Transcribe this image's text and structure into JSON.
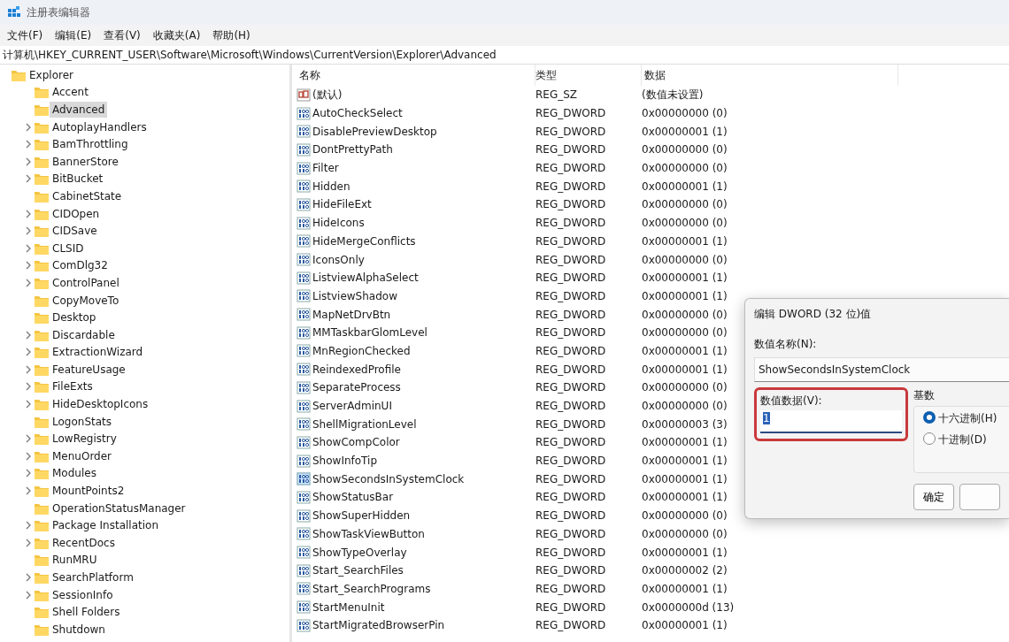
{
  "window": {
    "title": "注册表编辑器"
  },
  "menu": [
    "文件(F)",
    "编辑(E)",
    "查看(V)",
    "收藏夹(A)",
    "帮助(H)"
  ],
  "address": "计算机\\HKEY_CURRENT_USER\\Software\\Microsoft\\Windows\\CurrentVersion\\Explorer\\Advanced",
  "tree": [
    {
      "label": "Explorer",
      "expandable": false,
      "selected": false,
      "children": [
        {
          "label": "Accent",
          "expandable": false,
          "selected": false
        },
        {
          "label": "Advanced",
          "expandable": false,
          "selected": true
        },
        {
          "label": "AutoplayHandlers",
          "expandable": true,
          "selected": false
        },
        {
          "label": "BamThrottling",
          "expandable": true,
          "selected": false
        },
        {
          "label": "BannerStore",
          "expandable": true,
          "selected": false
        },
        {
          "label": "BitBucket",
          "expandable": true,
          "selected": false
        },
        {
          "label": "CabinetState",
          "expandable": false,
          "selected": false
        },
        {
          "label": "CIDOpen",
          "expandable": true,
          "selected": false
        },
        {
          "label": "CIDSave",
          "expandable": true,
          "selected": false
        },
        {
          "label": "CLSID",
          "expandable": true,
          "selected": false
        },
        {
          "label": "ComDlg32",
          "expandable": true,
          "selected": false
        },
        {
          "label": "ControlPanel",
          "expandable": true,
          "selected": false
        },
        {
          "label": "CopyMoveTo",
          "expandable": false,
          "selected": false
        },
        {
          "label": "Desktop",
          "expandable": false,
          "selected": false
        },
        {
          "label": "Discardable",
          "expandable": true,
          "selected": false
        },
        {
          "label": "ExtractionWizard",
          "expandable": true,
          "selected": false
        },
        {
          "label": "FeatureUsage",
          "expandable": true,
          "selected": false
        },
        {
          "label": "FileExts",
          "expandable": true,
          "selected": false
        },
        {
          "label": "HideDesktopIcons",
          "expandable": true,
          "selected": false
        },
        {
          "label": "LogonStats",
          "expandable": false,
          "selected": false
        },
        {
          "label": "LowRegistry",
          "expandable": true,
          "selected": false
        },
        {
          "label": "MenuOrder",
          "expandable": true,
          "selected": false
        },
        {
          "label": "Modules",
          "expandable": true,
          "selected": false
        },
        {
          "label": "MountPoints2",
          "expandable": true,
          "selected": false
        },
        {
          "label": "OperationStatusManager",
          "expandable": false,
          "selected": false
        },
        {
          "label": "Package Installation",
          "expandable": true,
          "selected": false
        },
        {
          "label": "RecentDocs",
          "expandable": true,
          "selected": false
        },
        {
          "label": "RunMRU",
          "expandable": false,
          "selected": false
        },
        {
          "label": "SearchPlatform",
          "expandable": true,
          "selected": false
        },
        {
          "label": "SessionInfo",
          "expandable": true,
          "selected": false
        },
        {
          "label": "Shell Folders",
          "expandable": false,
          "selected": false
        },
        {
          "label": "Shutdown",
          "expandable": false,
          "selected": false
        }
      ]
    }
  ],
  "table": {
    "columns": [
      "名称",
      "类型",
      "数据"
    ],
    "rows": [
      {
        "kind": "string",
        "name": "(默认)",
        "type": "REG_SZ",
        "data": "(数值未设置)",
        "selected": false
      },
      {
        "kind": "dword",
        "name": "AutoCheckSelect",
        "type": "REG_DWORD",
        "data": "0x00000000 (0)",
        "selected": false
      },
      {
        "kind": "dword",
        "name": "DisablePreviewDesktop",
        "type": "REG_DWORD",
        "data": "0x00000001 (1)",
        "selected": false
      },
      {
        "kind": "dword",
        "name": "DontPrettyPath",
        "type": "REG_DWORD",
        "data": "0x00000000 (0)",
        "selected": false
      },
      {
        "kind": "dword",
        "name": "Filter",
        "type": "REG_DWORD",
        "data": "0x00000000 (0)",
        "selected": false
      },
      {
        "kind": "dword",
        "name": "Hidden",
        "type": "REG_DWORD",
        "data": "0x00000001 (1)",
        "selected": false
      },
      {
        "kind": "dword",
        "name": "HideFileExt",
        "type": "REG_DWORD",
        "data": "0x00000000 (0)",
        "selected": false
      },
      {
        "kind": "dword",
        "name": "HideIcons",
        "type": "REG_DWORD",
        "data": "0x00000000 (0)",
        "selected": false
      },
      {
        "kind": "dword",
        "name": "HideMergeConflicts",
        "type": "REG_DWORD",
        "data": "0x00000001 (1)",
        "selected": false
      },
      {
        "kind": "dword",
        "name": "IconsOnly",
        "type": "REG_DWORD",
        "data": "0x00000000 (0)",
        "selected": false
      },
      {
        "kind": "dword",
        "name": "ListviewAlphaSelect",
        "type": "REG_DWORD",
        "data": "0x00000001 (1)",
        "selected": false
      },
      {
        "kind": "dword",
        "name": "ListviewShadow",
        "type": "REG_DWORD",
        "data": "0x00000001 (1)",
        "selected": false
      },
      {
        "kind": "dword",
        "name": "MapNetDrvBtn",
        "type": "REG_DWORD",
        "data": "0x00000000 (0)",
        "selected": false
      },
      {
        "kind": "dword",
        "name": "MMTaskbarGlomLevel",
        "type": "REG_DWORD",
        "data": "0x00000000 (0)",
        "selected": false
      },
      {
        "kind": "dword",
        "name": "MnRegionChecked",
        "type": "REG_DWORD",
        "data": "0x00000001 (1)",
        "selected": false
      },
      {
        "kind": "dword",
        "name": "ReindexedProfile",
        "type": "REG_DWORD",
        "data": "0x00000001 (1)",
        "selected": false
      },
      {
        "kind": "dword",
        "name": "SeparateProcess",
        "type": "REG_DWORD",
        "data": "0x00000000 (0)",
        "selected": false
      },
      {
        "kind": "dword",
        "name": "ServerAdminUI",
        "type": "REG_DWORD",
        "data": "0x00000000 (0)",
        "selected": false
      },
      {
        "kind": "dword",
        "name": "ShellMigrationLevel",
        "type": "REG_DWORD",
        "data": "0x00000003 (3)",
        "selected": false
      },
      {
        "kind": "dword",
        "name": "ShowCompColor",
        "type": "REG_DWORD",
        "data": "0x00000001 (1)",
        "selected": false
      },
      {
        "kind": "dword",
        "name": "ShowInfoTip",
        "type": "REG_DWORD",
        "data": "0x00000001 (1)",
        "selected": false
      },
      {
        "kind": "dword",
        "name": "ShowSecondsInSystemClock",
        "type": "REG_DWORD",
        "data": "0x00000001 (1)",
        "selected": true
      },
      {
        "kind": "dword",
        "name": "ShowStatusBar",
        "type": "REG_DWORD",
        "data": "0x00000001 (1)",
        "selected": false
      },
      {
        "kind": "dword",
        "name": "ShowSuperHidden",
        "type": "REG_DWORD",
        "data": "0x00000000 (0)",
        "selected": false
      },
      {
        "kind": "dword",
        "name": "ShowTaskViewButton",
        "type": "REG_DWORD",
        "data": "0x00000000 (0)",
        "selected": false
      },
      {
        "kind": "dword",
        "name": "ShowTypeOverlay",
        "type": "REG_DWORD",
        "data": "0x00000001 (1)",
        "selected": false
      },
      {
        "kind": "dword",
        "name": "Start_SearchFiles",
        "type": "REG_DWORD",
        "data": "0x00000002 (2)",
        "selected": false
      },
      {
        "kind": "dword",
        "name": "Start_SearchPrograms",
        "type": "REG_DWORD",
        "data": "0x00000001 (1)",
        "selected": false
      },
      {
        "kind": "dword",
        "name": "StartMenuInit",
        "type": "REG_DWORD",
        "data": "0x0000000d (13)",
        "selected": false
      },
      {
        "kind": "dword",
        "name": "StartMigratedBrowserPin",
        "type": "REG_DWORD",
        "data": "0x00000001 (1)",
        "selected": false
      }
    ]
  },
  "dialog": {
    "title": "编辑 DWORD (32 位)值",
    "name_label": "数值名称(N):",
    "name_value": "ShowSecondsInSystemClock",
    "data_label": "数值数据(V):",
    "data_value": "1",
    "radix_label": "基数",
    "radix": [
      {
        "label": "十六进制(H)",
        "selected": true
      },
      {
        "label": "十进制(D)",
        "selected": false
      }
    ],
    "buttons": [
      "确定"
    ]
  }
}
